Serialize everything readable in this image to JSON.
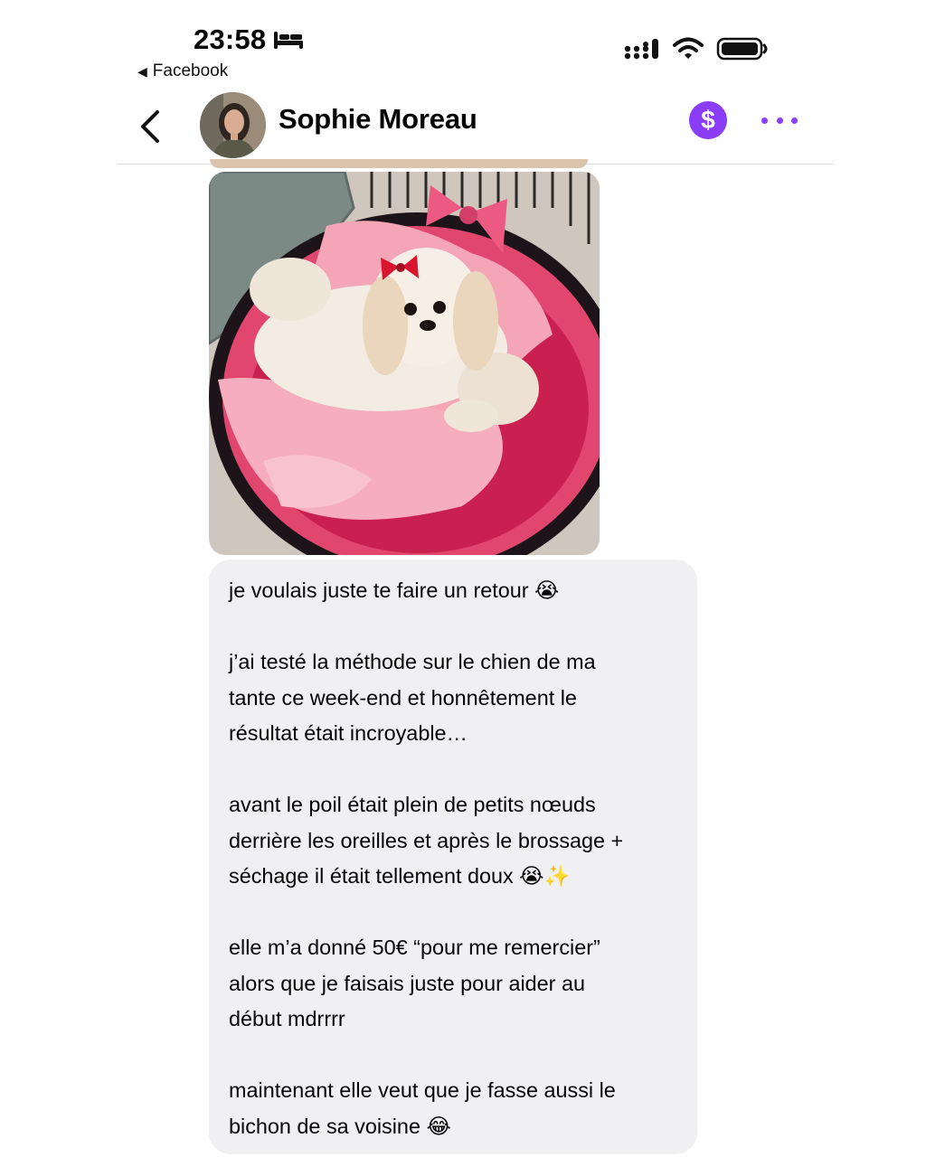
{
  "status_bar": {
    "time": "23:58",
    "back_app_label": "Facebook",
    "icons": [
      "bed-icon",
      "signal-icon",
      "wifi-icon",
      "battery-icon"
    ]
  },
  "chat_header": {
    "contact_name": "Sophie Moreau",
    "pay_symbol": "$",
    "accent_color": "#8b3cf6",
    "icons": [
      "back-chevron-icon",
      "avatar",
      "dollar-icon",
      "more-icon"
    ]
  },
  "messages": [
    {
      "type": "photo",
      "image_subject": "white shih tzu dog with red hair bow lying on a pink blanket in a pink and black pet bed"
    },
    {
      "type": "text",
      "paragraphs": [
        "je voulais juste te faire un retour 😭",
        "j’ai testé la méthode sur le chien de ma\ntante ce week-end et honnêtement le\nrésultat était incroyable…",
        "avant le poil était plein de petits nœuds\nderrière les oreilles et après le brossage +\nséchage il était tellement doux 😭✨",
        "elle m’a donné 50€ “pour me remercier”\nalors que je faisais juste pour aider au\ndébut mdrrrr",
        "maintenant elle veut que je fasse aussi le\nbichon de sa voisine 😂"
      ]
    }
  ]
}
